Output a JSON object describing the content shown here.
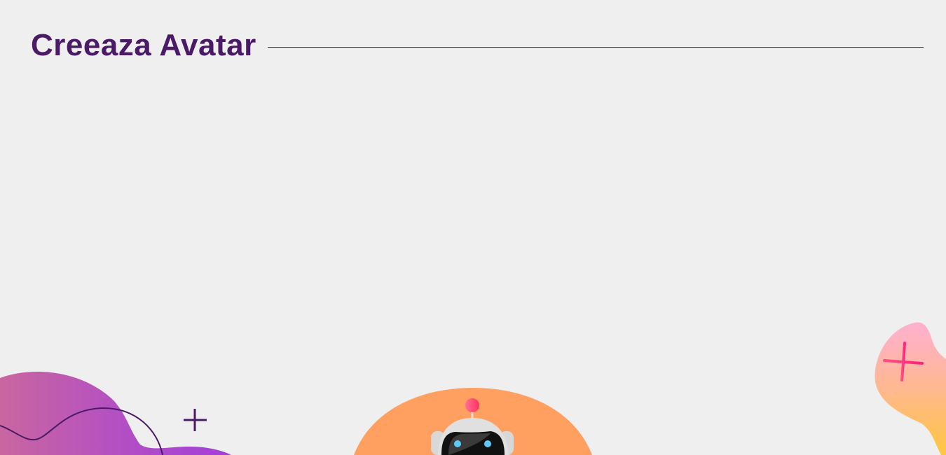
{
  "header": {
    "title": "Creeaza Avatar"
  },
  "colors": {
    "accent": "#4a1a66",
    "orange": "#ffa060",
    "pink": "#ff4d7a"
  },
  "decor": {
    "icons": [
      "blob-left",
      "plus-icon",
      "robot-avatar",
      "blob-right"
    ]
  }
}
